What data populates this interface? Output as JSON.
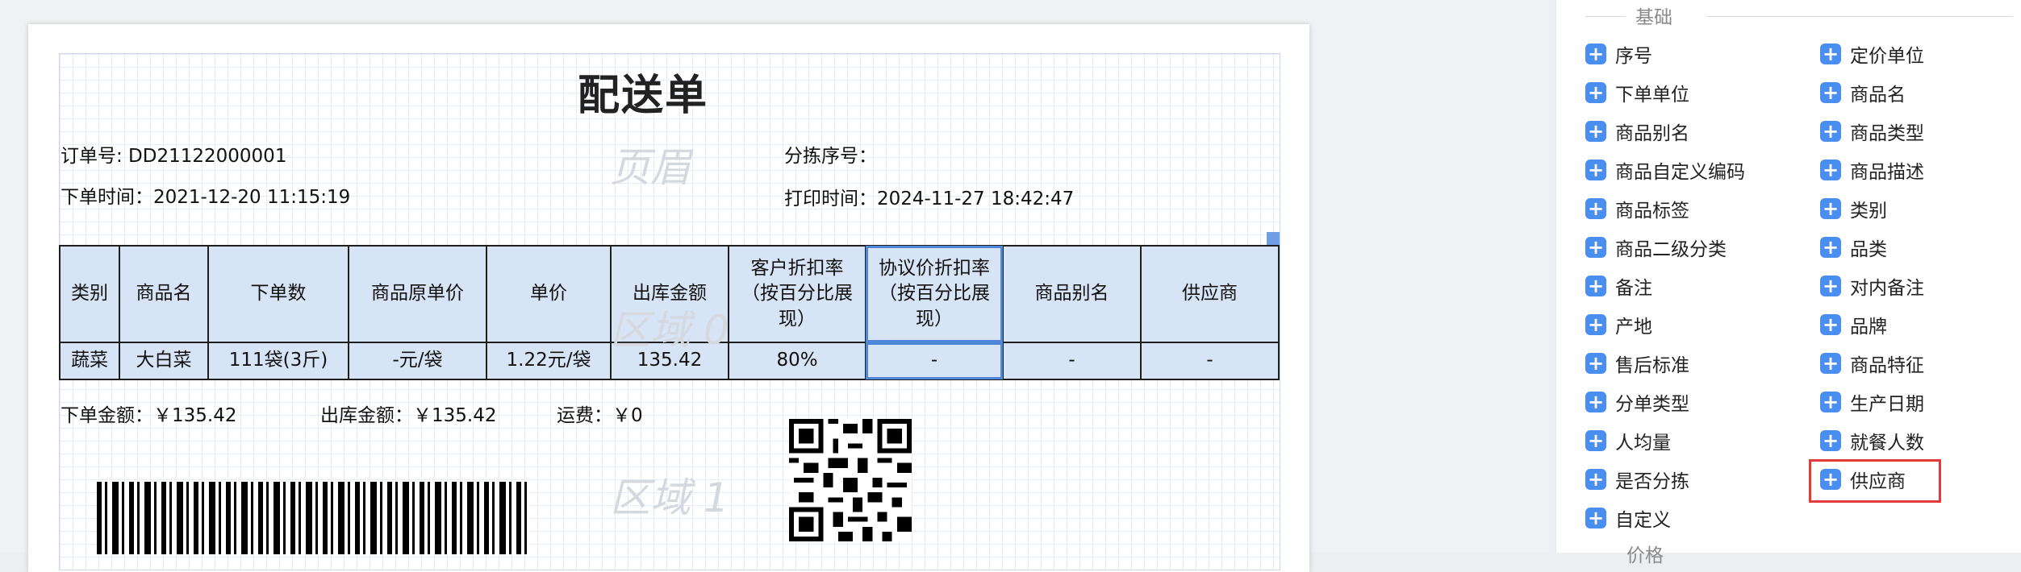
{
  "document": {
    "title": "配送单",
    "header_watermark": "页眉",
    "region0_watermark": "区域 0",
    "region1_watermark": "区域 1",
    "order_no": "订单号: DD21122000001",
    "order_time": "下单时间：2021-12-20 11:15:19",
    "sort_no": "分拣序号：",
    "print_time": "打印时间：2024-11-27 18:42:47",
    "order_amount": "下单金额：￥135.42",
    "out_amount": "出库金额：￥135.42",
    "freight": "运费：￥0"
  },
  "table": {
    "headers": [
      "类别",
      "商品名",
      "下单数",
      "商品原单价",
      "单价",
      "出库金额",
      "客户折扣率（按百分比展现）",
      "协议价折扣率（按百分比展现）",
      "商品别名",
      "供应商"
    ],
    "rows": [
      [
        "蔬菜",
        "大白菜",
        "111袋(3斤)",
        "-元/袋",
        "1.22元/袋",
        "135.42",
        "80%",
        "-",
        "-",
        "-"
      ]
    ]
  },
  "panel": {
    "section_title": "基础",
    "next_section": "价格",
    "left_items": [
      "序号",
      "下单单位",
      "商品别名",
      "商品自定义编码",
      "商品标签",
      "商品二级分类",
      "备注",
      "产地",
      "售后标准",
      "分单类型",
      "人均量",
      "是否分拣",
      "自定义"
    ],
    "right_items": [
      "定价单位",
      "商品名",
      "商品类型",
      "商品描述",
      "类别",
      "品类",
      "对内备注",
      "品牌",
      "商品特征",
      "生产日期",
      "就餐人数",
      "供应商"
    ]
  },
  "icons": {
    "add": "plus-icon",
    "plus_glyph": "+"
  },
  "colors": {
    "accent": "#4a8ff0",
    "highlight": "#e23a3a",
    "table_fill": "#d7e4f6"
  }
}
